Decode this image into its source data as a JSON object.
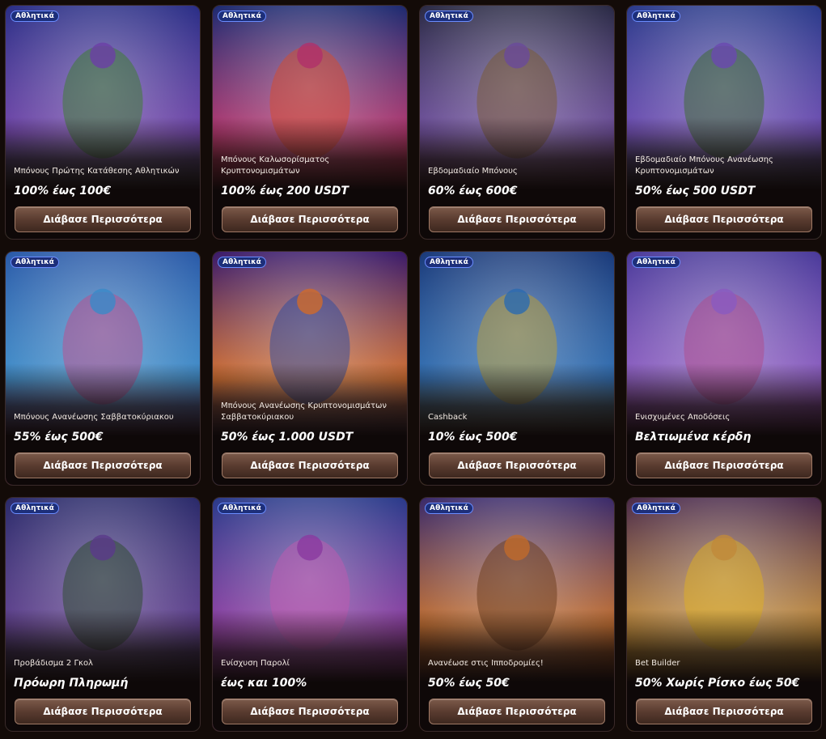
{
  "button_label": "Διάβασε Περισσότερα",
  "cards": [
    {
      "badge": "Αθλητικά",
      "subtitle": "Μπόνους Πρώτης Κατάθεσης Αθλητικών",
      "offer": "100% έως 100€",
      "art": "soccer-players-illustration",
      "colors": [
        "#2a2e86",
        "#6b3fa6",
        "#3a7d2a"
      ]
    },
    {
      "badge": "Αθλητικά",
      "subtitle": "Μπόνους Καλωσορίσματος Κρυπτονομισμάτων",
      "offer": "100% έως 200 USDT",
      "art": "cowgirl-race-car-illustration",
      "colors": [
        "#1d2a70",
        "#b0306a",
        "#d64a2a"
      ]
    },
    {
      "badge": "Αθλητικά",
      "subtitle": "Εβδομαδιαίο Μπόνους",
      "offer": "60% έως 600€",
      "art": "quad-bike-riders-illustration",
      "colors": [
        "#2a2a45",
        "#6a4a9a",
        "#7a5a30"
      ]
    },
    {
      "badge": "Αθλητικά",
      "subtitle": "Εβδομαδιαίο Μπόνους Ανανέωσης Κρυπτονομισμάτων",
      "offer": "50% έως 500 USDT",
      "art": "crypto-baseball-illustration",
      "colors": [
        "#2a3a8a",
        "#6a48b0",
        "#3a6a2a"
      ]
    },
    {
      "badge": "Αθλητικά",
      "subtitle": "Μπόνους Ανανέωσης Σαββατοκύριακου",
      "offer": "55% έως 500€",
      "art": "pool-floats-illustration",
      "colors": [
        "#2a5aa8",
        "#3a8ac8",
        "#c04a8a"
      ]
    },
    {
      "badge": "Αθλητικά",
      "subtitle": "Μπόνους Ανανέωσης Κρυπτονομισμάτων Σαββατοκύριακου",
      "offer": "50% έως 1.000 USDT",
      "art": "neon-wings-crypto-illustration",
      "colors": [
        "#3a1a6a",
        "#d06a2a",
        "#2a4aa0"
      ]
    },
    {
      "badge": "Αθλητικά",
      "subtitle": "Cashback",
      "offer": "10% έως 500€",
      "art": "dartboard-percent-illustration",
      "colors": [
        "#1a3a7a",
        "#2a6ab0",
        "#c0a030"
      ]
    },
    {
      "badge": "Αθλητικά",
      "subtitle": "Ενισχυμένες Αποδόσεις",
      "offer": "Βελτιωμένα κέρδη",
      "art": "basketball-hoverboard-illustration",
      "colors": [
        "#4a3a9a",
        "#8a5ac0",
        "#b04a8a"
      ]
    },
    {
      "badge": "Αθλητικά",
      "subtitle": "Προβάδισμα 2 Γκολ",
      "offer": "Πρόωρη Πληρωμή",
      "art": "bulls-stadium-illustration",
      "colors": [
        "#2a2a6a",
        "#5a3a8a",
        "#2a4a2a"
      ]
    },
    {
      "badge": "Αθλητικά",
      "subtitle": "Ενίσχυση Παρολί",
      "offer": "έως και 100%",
      "art": "monster-truck-cowgirl-illustration",
      "colors": [
        "#2a3a8a",
        "#8a3aa0",
        "#c05ab0"
      ]
    },
    {
      "badge": "Αθλητικά",
      "subtitle": "Ανανέωσε στις Ιπποδρομίες!",
      "offer": "50% έως 50€",
      "art": "horse-racing-illustration",
      "colors": [
        "#3a2a6a",
        "#c06a2a",
        "#6a3a1a"
      ]
    },
    {
      "badge": "Αθλητικά",
      "subtitle": "Bet Builder",
      "offer": "50% Χωρίς Ρίσκο έως 50€",
      "art": "garage-yellow-car-illustration",
      "colors": [
        "#4a2a4a",
        "#c08a3a",
        "#e0b020"
      ]
    }
  ]
}
